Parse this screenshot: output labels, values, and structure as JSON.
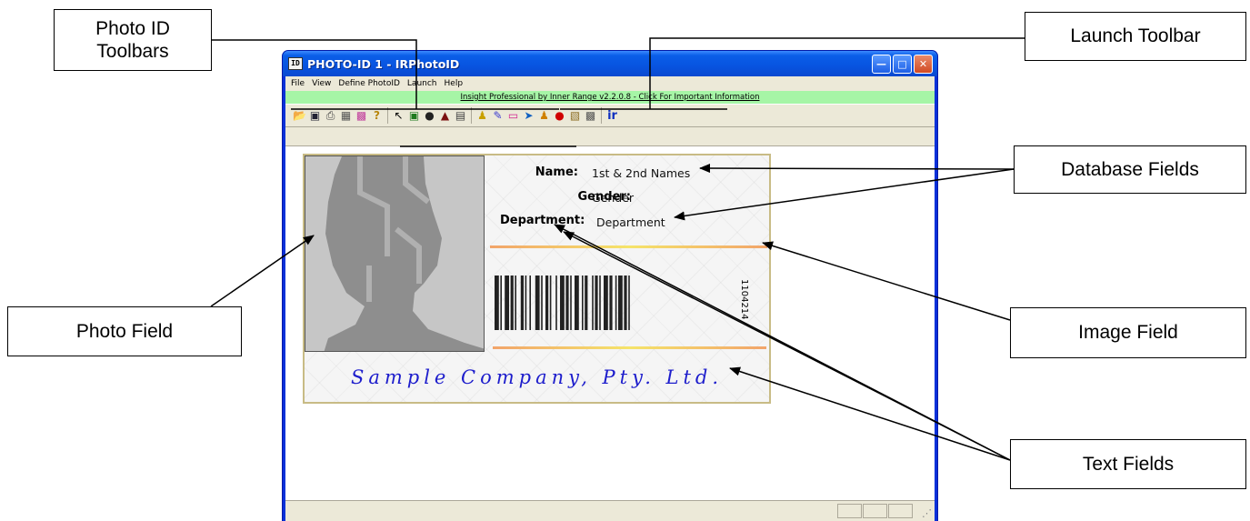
{
  "callouts": {
    "photo_id_toolbars": "Photo ID\nToolbars",
    "launch_toolbar": "Launch Toolbar",
    "database_fields": "Database Fields",
    "image_field": "Image Field",
    "photo_field": "Photo Field",
    "text_fields": "Text Fields"
  },
  "window": {
    "icon_text": "ID",
    "title": "PHOTO-ID 1 - IRPhotoID",
    "menu": [
      "File",
      "View",
      "Define PhotoID",
      "Launch",
      "Help"
    ],
    "info_bar": "Insight Professional by Inner Range v2.2.0.8 - Click For Important Information"
  },
  "toolbars": {
    "file_group": [
      "open-folder-icon",
      "save-icon",
      "print-icon",
      "grid-icon",
      "palette-icon",
      "help-icon"
    ],
    "design_group": [
      "pointer-icon",
      "image-icon",
      "photo-silhouette-icon",
      "stamp-icon",
      "frame-icon"
    ],
    "launch_group": [
      "person-icon",
      "pen-icon",
      "card-icon",
      "tag-icon",
      "person-badge-icon",
      "alarm-icon",
      "document-icon",
      "monitor-icon"
    ],
    "brand_group": [
      "ir-logo-icon"
    ]
  },
  "card": {
    "fields": [
      {
        "label": "Name:",
        "value": "1st & 2nd Names"
      },
      {
        "label": "Gender:",
        "value": "Gender"
      },
      {
        "label": "Department:",
        "value": "Department"
      }
    ],
    "barcode_number": "1104214",
    "company": "Sample Company, Pty. Ltd."
  },
  "colors": {
    "titlebar": "#0a5ee8",
    "info_bar": "#a6f5a6",
    "company_text": "#1d1dcc",
    "card_border": "#c8bb85"
  }
}
